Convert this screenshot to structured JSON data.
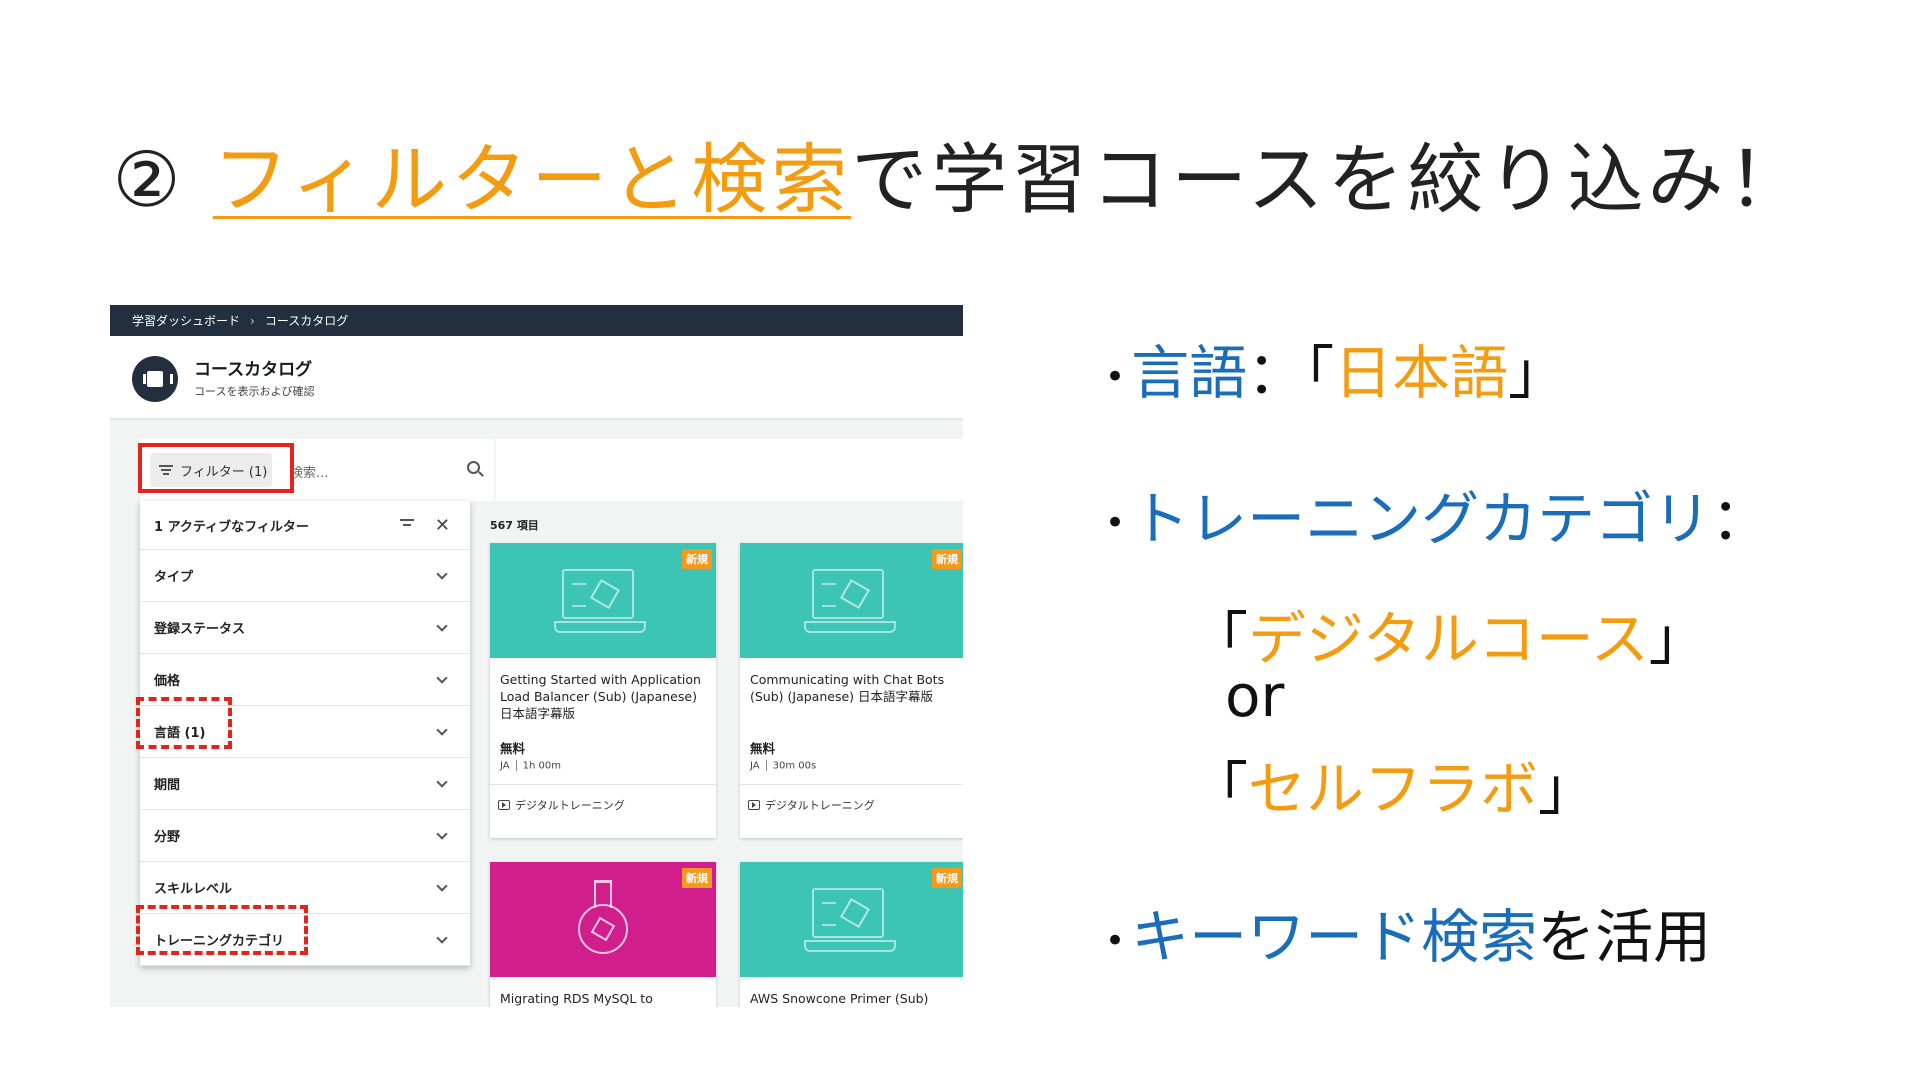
{
  "slide": {
    "title_prefix": "② ",
    "title_highlight": "フィルターと検索",
    "title_suffix": "で学習コースを絞り込み！"
  },
  "screenshot": {
    "breadcrumb": {
      "dashboard": "学習ダッシュボード",
      "separator": "›",
      "catalog": "コースカタログ"
    },
    "header": {
      "title": "コースカタログ",
      "subtitle": "コースを表示および確認"
    },
    "search": {
      "filter_label": "フィルター (1)",
      "placeholder": "検索..."
    },
    "filter_panel": {
      "active_label": "1 アクティブなフィルター",
      "close_glyph": "✕",
      "rows": [
        "タイプ",
        "登録ステータス",
        "価格",
        "言語 (1)",
        "期間",
        "分野",
        "スキルレベル",
        "トレーニングカテゴリ"
      ]
    },
    "results_count": "567 項目",
    "cards": [
      {
        "badge": "新規",
        "title": "Getting Started with Application Load Balancer (Sub) (Japanese) 日本語字幕版",
        "price": "無料",
        "lang": "JA",
        "duration": "1h 00m",
        "category": "デジタルトレーニング",
        "color": "#3cc4b4"
      },
      {
        "badge": "新規",
        "title": "Communicating with Chat Bots (Sub) (Japanese) 日本語字幕版",
        "price": "無料",
        "lang": "JA",
        "duration": "30m 00s",
        "category": "デジタルトレーニング",
        "color": "#3cc4b4"
      },
      {
        "badge": "新規",
        "title": "Migrating RDS MySQL to",
        "color": "#d01f8c"
      },
      {
        "badge": "新規",
        "title": "AWS Snowcone Primer (Sub)",
        "color": "#3cc4b4"
      }
    ]
  },
  "bullets": {
    "lang_label": "言語",
    "lang_colon": "：「",
    "lang_value": "日本語",
    "lang_close": "」",
    "category_label": "トレーニングカテゴリ",
    "category_colon": "：",
    "digital_open": "「",
    "digital_value": "デジタルコース",
    "digital_close": "」",
    "or_text": "or",
    "selflab_open": "「",
    "selflab_value": "セルフラボ",
    "selflab_close": "」",
    "keyword_label": "キーワード検索",
    "keyword_suffix": "を活用",
    "bullet_glyph": "•"
  },
  "colors": {
    "accent_orange": "#f39c12",
    "accent_blue": "#1a6db8",
    "highlight_red": "#e3241a",
    "topbar": "#232f3e"
  }
}
